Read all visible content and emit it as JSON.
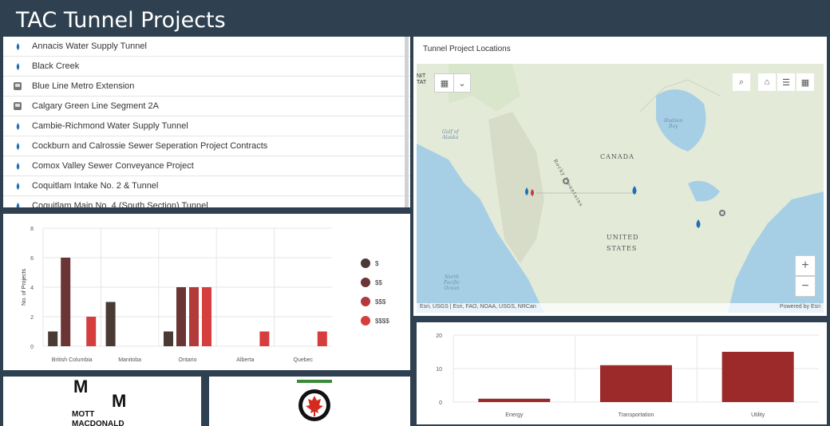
{
  "header": {
    "title": "TAC Tunnel Projects"
  },
  "project_list": {
    "items": [
      {
        "label": "Annacis Water Supply Tunnel",
        "icon": "water-drop-icon"
      },
      {
        "label": "Black Creek",
        "icon": "water-drop-icon"
      },
      {
        "label": "Blue Line Metro Extension",
        "icon": "metro-icon"
      },
      {
        "label": "Calgary Green Line Segment 2A",
        "icon": "metro-icon"
      },
      {
        "label": "Cambie-Richmond Water Supply Tunnel",
        "icon": "water-drop-icon"
      },
      {
        "label": "Cockburn and Calrossie Sewer Seperation Project Contracts",
        "icon": "water-drop-icon"
      },
      {
        "label": "Comox Valley Sewer Conveyance Project",
        "icon": "water-drop-icon"
      },
      {
        "label": "Coquitlam Intake No. 2 & Tunnel",
        "icon": "water-drop-icon"
      },
      {
        "label": "Coquitlam Main No. 4 (South Section) Tunnel",
        "icon": "water-drop-icon"
      }
    ]
  },
  "map": {
    "title": "Tunnel Project Locations",
    "labels": {
      "country1": "CANADA",
      "country2a": "UNITED",
      "country2b": "STATES",
      "range": "Rocky Mountains",
      "bay1": "Hudson",
      "bay2": "Bay",
      "gulf1": "Gulf of",
      "gulf2": "Alaska",
      "ocean1": "North",
      "ocean2": "Pacific",
      "ocean3": "Ocean"
    },
    "attribution": "Esri, USGS | Esri, FAO, NOAA, USGS, NRCan",
    "powered": "Powered by Esri",
    "zoom_in": "+",
    "zoom_out": "−",
    "edge_fragment": "NIT\nTAT"
  },
  "colors": {
    "header_bg": "#2f4150",
    "dark1": "#4a3a34",
    "dark2": "#6b3535",
    "red1": "#b23a3a",
    "red2": "#d63d3d",
    "bar2": "#9c2a2a",
    "drop": "#1e6fb8"
  },
  "chart_data": [
    {
      "type": "bar",
      "categories": [
        "British Columbia",
        "Manitoba",
        "Ontario",
        "Alberta",
        "Quebec"
      ],
      "series": [
        {
          "name": "$",
          "values": [
            1,
            3,
            1,
            0,
            0
          ],
          "color": "#4a3a34"
        },
        {
          "name": "$$",
          "values": [
            6,
            0,
            4,
            0,
            0
          ],
          "color": "#6b3535"
        },
        {
          "name": "$$$",
          "values": [
            0,
            0,
            4,
            0,
            0
          ],
          "color": "#b23a3a"
        },
        {
          "name": "$$$$",
          "values": [
            2,
            0,
            4,
            1,
            1
          ],
          "color": "#d63d3d"
        }
      ],
      "ylabel": "No. of Projects",
      "yticks": [
        0,
        2,
        4,
        6,
        8
      ],
      "ylim": [
        0,
        8
      ],
      "legend": "right"
    },
    {
      "type": "bar",
      "categories": [
        "Energy",
        "Transportation",
        "Utility"
      ],
      "values": [
        1,
        11,
        15
      ],
      "yticks": [
        0,
        10,
        20
      ],
      "ylim": [
        0,
        20
      ],
      "color": "#9c2a2a"
    }
  ],
  "logos": {
    "mott_line1": "MOTT",
    "mott_line2": "MACDONALD",
    "mott_m": "M"
  }
}
